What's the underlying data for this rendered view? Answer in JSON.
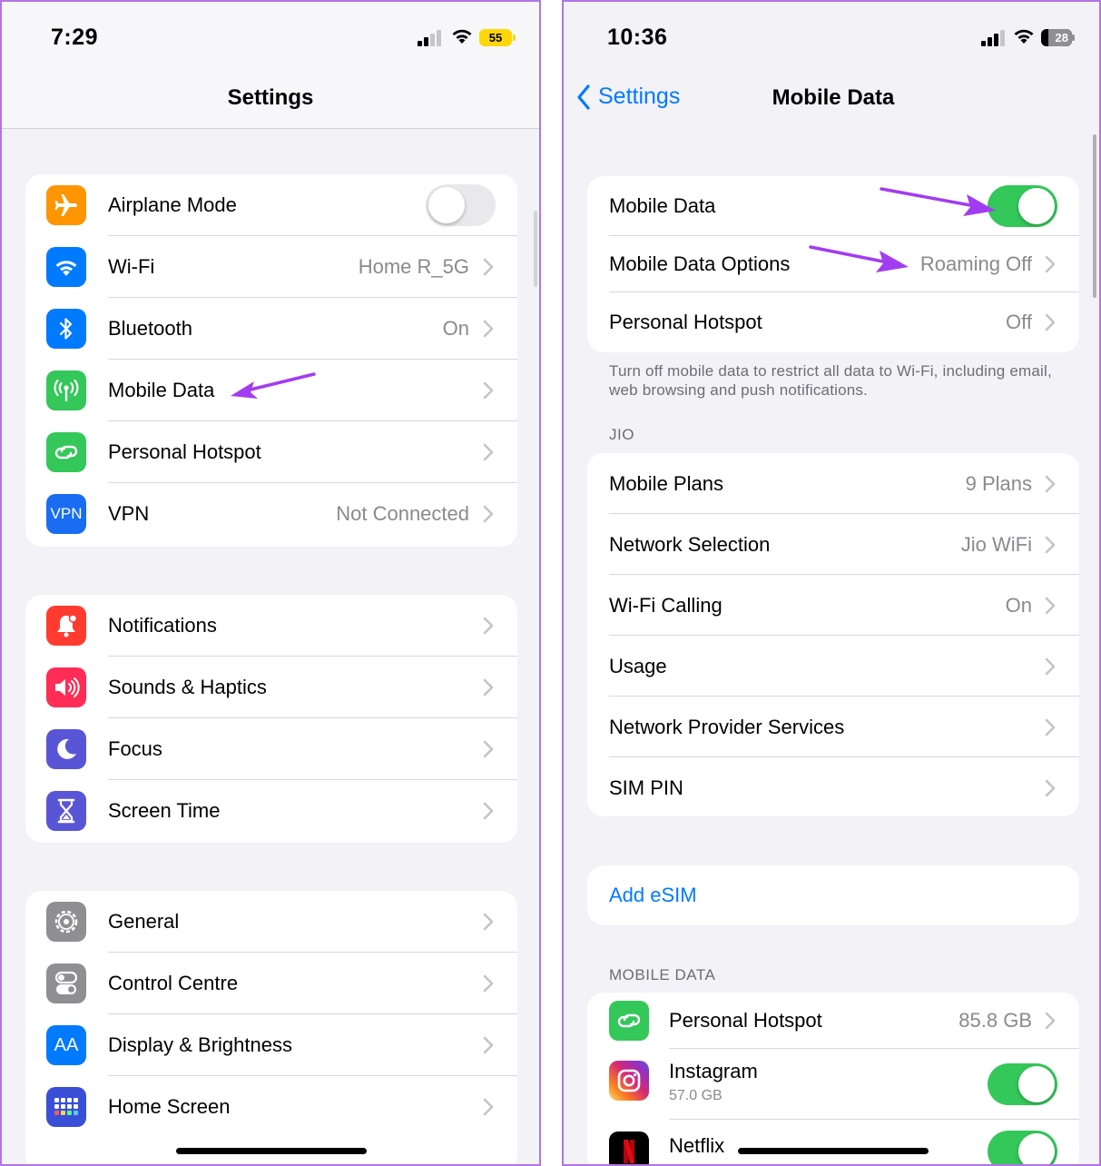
{
  "left": {
    "status": {
      "time": "7:29",
      "battery": "55"
    },
    "title": "Settings",
    "groups": [
      [
        {
          "label": "Airplane Mode",
          "icon": "airplane-icon",
          "color": "#ff9500",
          "toggle": "off"
        },
        {
          "label": "Wi-Fi",
          "value": "Home R_5G",
          "icon": "wifi-icon",
          "color": "#007aff"
        },
        {
          "label": "Bluetooth",
          "value": "On",
          "icon": "bluetooth-icon",
          "color": "#007aff"
        },
        {
          "label": "Mobile Data",
          "icon": "antenna-icon",
          "color": "#34c759"
        },
        {
          "label": "Personal Hotspot",
          "icon": "hotspot-link-icon",
          "color": "#34c759"
        },
        {
          "label": "VPN",
          "value": "Not Connected",
          "icon": "vpn-icon",
          "icon_text": "VPN",
          "color": "#1a6df0"
        }
      ],
      [
        {
          "label": "Notifications",
          "icon": "bell-icon",
          "color": "#ff3b30"
        },
        {
          "label": "Sounds & Haptics",
          "icon": "speaker-icon",
          "color": "#ff2d55"
        },
        {
          "label": "Focus",
          "icon": "moon-icon",
          "color": "#5856d6"
        },
        {
          "label": "Screen Time",
          "icon": "hourglass-icon",
          "color": "#5856d6"
        }
      ],
      [
        {
          "label": "General",
          "icon": "gear-icon",
          "color": "#8e8e93"
        },
        {
          "label": "Control Centre",
          "icon": "switches-icon",
          "color": "#8e8e93"
        },
        {
          "label": "Display & Brightness",
          "icon": "text-size-icon",
          "icon_text": "AA",
          "color": "#007aff"
        },
        {
          "label": "Home Screen",
          "icon": "home-grid-icon",
          "color": "#3a4fd8"
        }
      ]
    ]
  },
  "right": {
    "status": {
      "time": "10:36",
      "battery": "28"
    },
    "back_label": "Settings",
    "title": "Mobile Data",
    "main_group": [
      {
        "label": "Mobile Data",
        "toggle": "on"
      },
      {
        "label": "Mobile Data Options",
        "value": "Roaming Off"
      },
      {
        "label": "Personal Hotspot",
        "value": "Off"
      }
    ],
    "footnote": "Turn off mobile data to restrict all data to Wi-Fi, including email, web browsing and push notifications.",
    "carrier_header": "JIO",
    "carrier_group": [
      {
        "label": "Mobile Plans",
        "value": "9 Plans"
      },
      {
        "label": "Network Selection",
        "value": "Jio WiFi"
      },
      {
        "label": "Wi-Fi Calling",
        "value": "On"
      },
      {
        "label": "Usage",
        "value": ""
      },
      {
        "label": "Network Provider Services",
        "value": ""
      },
      {
        "label": "SIM PIN",
        "value": ""
      }
    ],
    "add_esim": "Add eSIM",
    "mobile_data_header": "MOBILE DATA",
    "apps": [
      {
        "label": "Personal Hotspot",
        "value": "85.8 GB",
        "icon": "hotspot-link-icon"
      },
      {
        "label": "Instagram",
        "sub": "57.0 GB",
        "icon": "instagram-icon",
        "toggle": "on"
      },
      {
        "label": "Netflix",
        "sub": "",
        "icon": "netflix-icon",
        "toggle": "on"
      }
    ]
  },
  "colors": {
    "accent": "#007aff",
    "toggle_on": "#34c759",
    "annotation_arrow": "#a23cf0",
    "frame_border": "#b374e6"
  }
}
